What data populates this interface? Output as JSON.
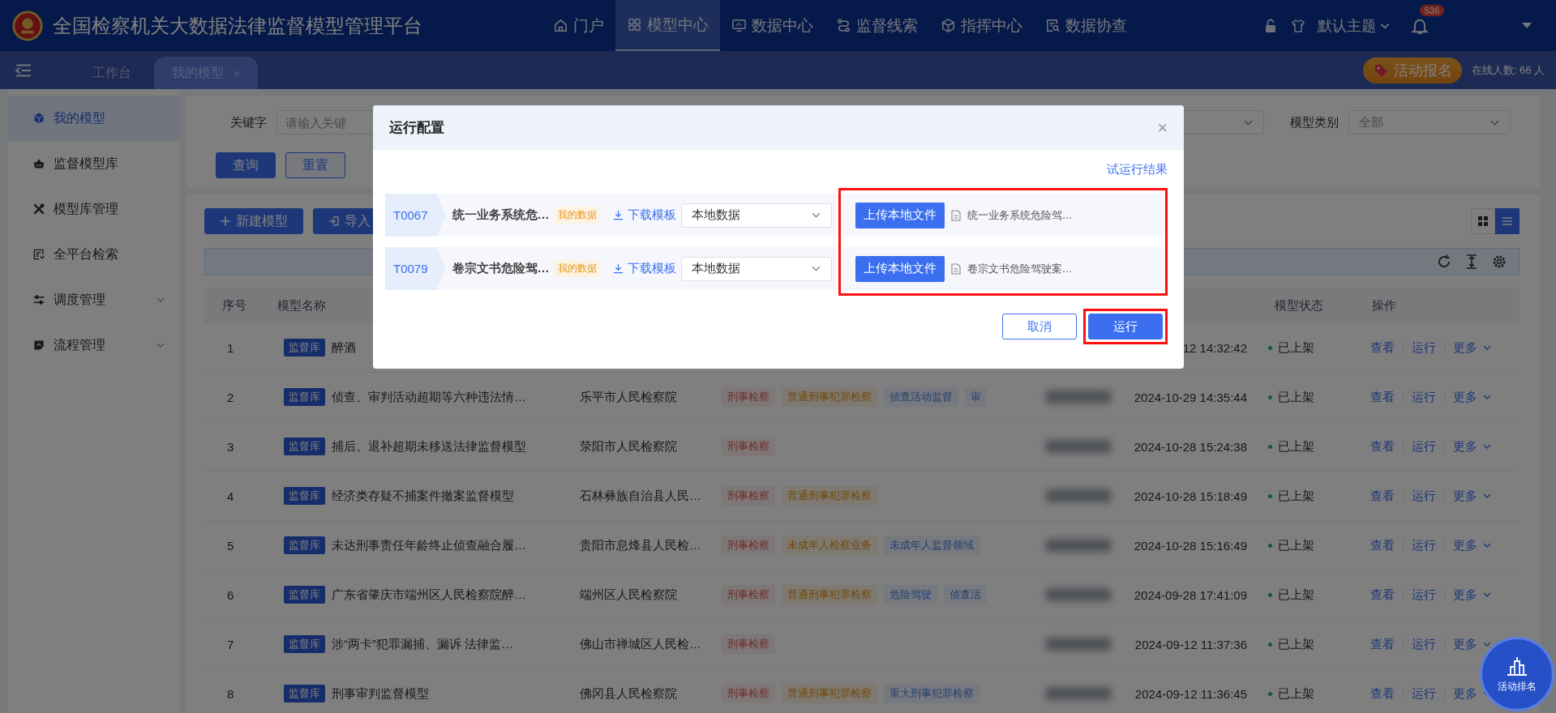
{
  "header": {
    "title": "全国检察机关大数据法律监督模型管理平台",
    "nav": [
      {
        "label": "门户",
        "selected": false
      },
      {
        "label": "模型中心",
        "selected": true
      },
      {
        "label": "数据中心",
        "selected": false
      },
      {
        "label": "监督线索",
        "selected": false
      },
      {
        "label": "指挥中心",
        "selected": false
      },
      {
        "label": "数据协查",
        "selected": false
      }
    ],
    "theme": "默认主题",
    "notifications": "536"
  },
  "tabs": [
    {
      "label": "工作台",
      "selected": false
    },
    {
      "label": "我的模型",
      "selected": true,
      "close": "×"
    }
  ],
  "event_button": "活动报名",
  "online": "在线人数: 66 人",
  "sidebar": [
    {
      "label": "我的模型",
      "selected": true,
      "expandable": false
    },
    {
      "label": "监督模型库",
      "selected": false,
      "expandable": false
    },
    {
      "label": "模型库管理",
      "selected": false,
      "expandable": false
    },
    {
      "label": "全平台检索",
      "selected": false,
      "expandable": false
    },
    {
      "label": "调度管理",
      "selected": false,
      "expandable": true
    },
    {
      "label": "流程管理",
      "selected": false,
      "expandable": true
    }
  ],
  "filters": {
    "keyword_label": "关键字",
    "keyword_placeholder": "请输入关键",
    "category_label": "模型类别",
    "category_placeholder": "全部",
    "buttons": [
      {
        "label": "查询",
        "kind": "primary"
      },
      {
        "label": "重置",
        "kind": "outline"
      }
    ]
  },
  "toolbar": {
    "buttons": [
      {
        "label": "新建模型"
      },
      {
        "label": "导入"
      }
    ],
    "views": [
      {
        "selected": false
      },
      {
        "selected": true
      }
    ]
  },
  "table": {
    "columns": [
      {
        "label": "序号"
      },
      {
        "label": "模型名称"
      },
      {
        "label": "模型状态"
      },
      {
        "label": "操作"
      }
    ],
    "rows": [
      {
        "no": "1",
        "source": "监督库",
        "name": "醉酒",
        "tags": [],
        "time": "12 14:32:42",
        "status": "已上架",
        "actions": [
          "查看",
          "运行",
          "更多"
        ]
      },
      {
        "no": "2",
        "source": "监督库",
        "name": "侦查、审判活动超期等六种违法情…",
        "org": "乐平市人民检察院",
        "tags": [
          {
            "label": "刑事检察",
            "kind": "department"
          },
          {
            "label": "普通刑事犯罪检察",
            "kind": "business"
          },
          {
            "label": "侦查活动监督",
            "kind": "field"
          },
          {
            "label": "审",
            "kind": "field"
          }
        ],
        "time": "2024-10-29 14:35:44",
        "status": "已上架",
        "actions": [
          "查看",
          "运行",
          "更多"
        ]
      },
      {
        "no": "3",
        "source": "监督库",
        "name": "捕后、退补超期未移送法律监督模型",
        "org": "荥阳市人民检察院",
        "tags": [
          {
            "label": "刑事检察",
            "kind": "department"
          }
        ],
        "time": "2024-10-28 15:24:38",
        "status": "已上架",
        "actions": [
          "查看",
          "运行",
          "更多"
        ]
      },
      {
        "no": "4",
        "source": "监督库",
        "name": "经济类存疑不捕案件撤案监督模型",
        "org": "石林彝族自治县人民…",
        "tags": [
          {
            "label": "刑事检察",
            "kind": "department"
          },
          {
            "label": "普通刑事犯罪检察",
            "kind": "business"
          }
        ],
        "time": "2024-10-28 15:18:49",
        "status": "已上架",
        "actions": [
          "查看",
          "运行",
          "更多"
        ]
      },
      {
        "no": "5",
        "source": "监督库",
        "name": "未达刑事责任年龄终止侦查融合履…",
        "org": "贵阳市息烽县人民检…",
        "tags": [
          {
            "label": "刑事检察",
            "kind": "department"
          },
          {
            "label": "未成年人检察业务",
            "kind": "business"
          },
          {
            "label": "未成年人监督领域",
            "kind": "field"
          }
        ],
        "time": "2024-10-28 15:16:49",
        "status": "已上架",
        "actions": [
          "查看",
          "运行",
          "更多"
        ]
      },
      {
        "no": "6",
        "source": "监督库",
        "name": "广东省肇庆市端州区人民检察院醉…",
        "org": "端州区人民检察院",
        "tags": [
          {
            "label": "刑事检察",
            "kind": "department"
          },
          {
            "label": "普通刑事犯罪检察",
            "kind": "business"
          },
          {
            "label": "危险驾驶",
            "kind": "field"
          },
          {
            "label": "侦查活",
            "kind": "field"
          }
        ],
        "time": "2024-09-28 17:41:09",
        "status": "已上架",
        "actions": [
          "查看",
          "运行",
          "更多"
        ]
      },
      {
        "no": "7",
        "source": "监督库",
        "name": "涉“两卡”犯罪漏捕、漏诉 法律监…",
        "org": "佛山市禅城区人民检…",
        "tags": [
          {
            "label": "刑事检察",
            "kind": "department"
          }
        ],
        "time": "2024-09-12 11:37:36",
        "status": "已上架",
        "actions": [
          "查看",
          "运行",
          "更多"
        ]
      },
      {
        "no": "8",
        "source": "监督库",
        "name": "刑事审判监督模型",
        "org": "佛冈县人民检察院",
        "tags": [
          {
            "label": "刑事检察",
            "kind": "department"
          },
          {
            "label": "普通刑事犯罪检察",
            "kind": "business"
          },
          {
            "label": "重大刑事犯罪检察",
            "kind": "field"
          }
        ],
        "time": "2024-09-12 11:36:45",
        "status": "已上架",
        "actions": [
          "查看",
          "运行",
          "更多"
        ]
      }
    ]
  },
  "modal": {
    "title": "运行配置",
    "close": "×",
    "result_link": "试运行结果",
    "upload_highlighted": true,
    "items": [
      {
        "code": "T0067",
        "name": "统一业务系统危…",
        "tag": "我的数据",
        "download": "下载模板",
        "source": "本地数据",
        "upload": "上传本地文件",
        "file": "统一业务系统危险驾…"
      },
      {
        "code": "T0079",
        "name": "卷宗文书危险驾…",
        "tag": "我的数据",
        "download": "下载模板",
        "source": "本地数据",
        "upload": "上传本地文件",
        "file": "卷宗文书危险驾驶案…"
      }
    ],
    "buttons": [
      {
        "label": "取消",
        "kind": "default",
        "highlighted": false
      },
      {
        "label": "运行",
        "kind": "primary",
        "highlighted": true
      }
    ]
  },
  "float_button": "活动排名"
}
